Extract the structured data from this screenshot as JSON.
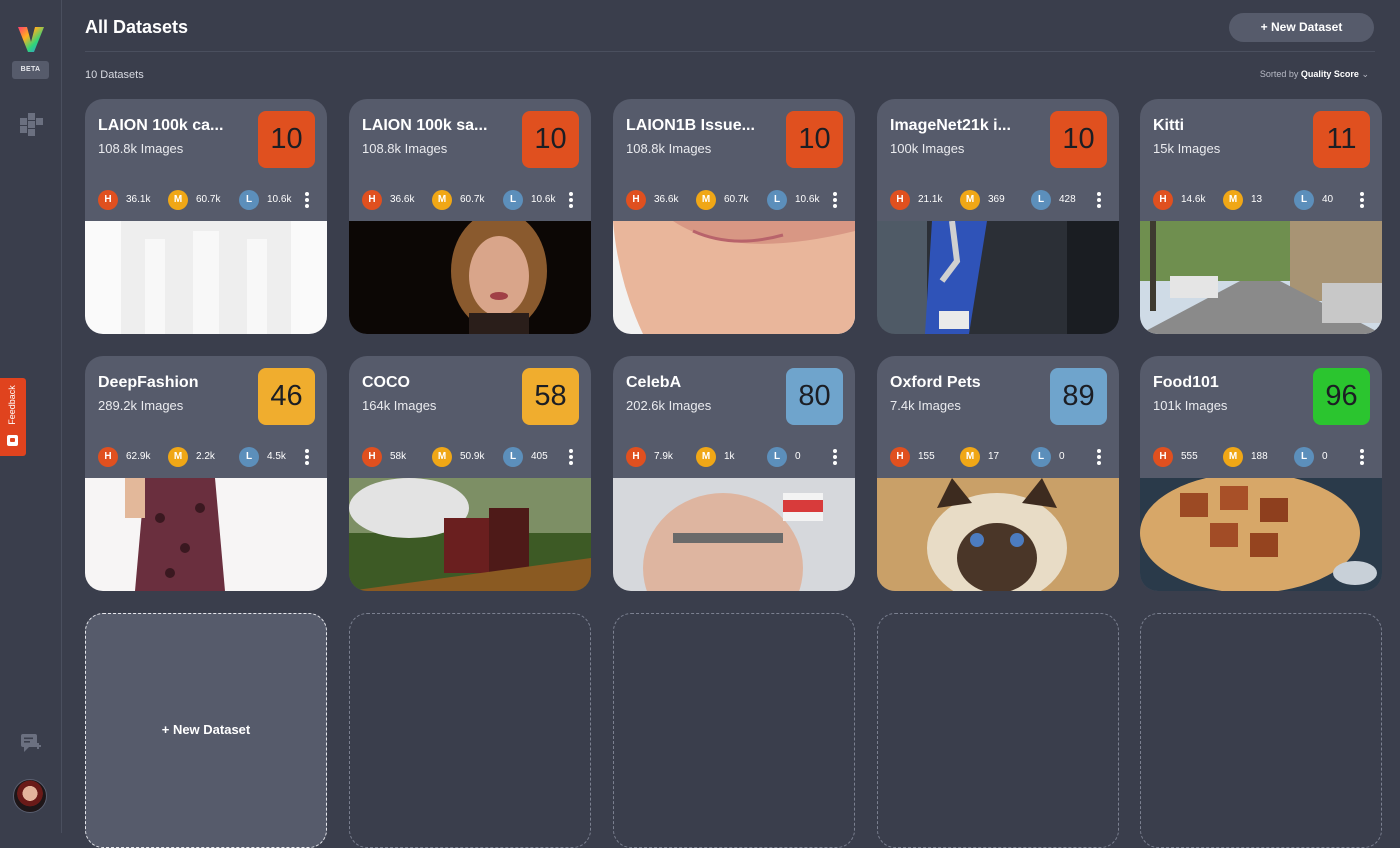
{
  "sidebar": {
    "beta_label": "BETA",
    "feedback_label": "Feedback"
  },
  "header": {
    "title": "All Datasets",
    "new_button": "+ New Dataset",
    "count_label": "10 Datasets",
    "sort_prefix": "Sorted by",
    "sort_value": "Quality Score"
  },
  "colors": {
    "H": "#e0501f",
    "M": "#f0a716",
    "L": "#5c8fbb",
    "score_low": "#e0501f",
    "score_mid": "#f0ad2e",
    "score_high": "#6fa4cc",
    "score_top": "#2bc52f"
  },
  "datasets": [
    {
      "name": "LAION 100k ca...",
      "count": "108.8k Images",
      "score": "10",
      "h": "36.1k",
      "m": "60.7k",
      "l": "10.6k",
      "thumb": "logo-placeholder"
    },
    {
      "name": "LAION 100k sa...",
      "count": "108.8k Images",
      "score": "10",
      "h": "36.6k",
      "m": "60.7k",
      "l": "10.6k",
      "thumb": "portrait-dark"
    },
    {
      "name": "LAION1B Issue...",
      "count": "108.8k Images",
      "score": "10",
      "h": "36.6k",
      "m": "60.7k",
      "l": "10.6k",
      "thumb": "skin-closeup"
    },
    {
      "name": "ImageNet21k i...",
      "count": "100k Images",
      "score": "10",
      "h": "21.1k",
      "m": "369",
      "l": "428",
      "thumb": "runner"
    },
    {
      "name": "Kitti",
      "count": "15k Images",
      "score": "11",
      "h": "14.6k",
      "m": "13",
      "l": "40",
      "thumb": "street"
    },
    {
      "name": "DeepFashion",
      "count": "289.2k Images",
      "score": "46",
      "h": "62.9k",
      "m": "2.2k",
      "l": "4.5k",
      "thumb": "dress"
    },
    {
      "name": "COCO",
      "count": "164k Images",
      "score": "58",
      "h": "58k",
      "m": "50.9k",
      "l": "405",
      "thumb": "train"
    },
    {
      "name": "CelebA",
      "count": "202.6k Images",
      "score": "80",
      "h": "7.9k",
      "m": "1k",
      "l": "0",
      "thumb": "face"
    },
    {
      "name": "Oxford Pets",
      "count": "7.4k Images",
      "score": "89",
      "h": "155",
      "m": "17",
      "l": "0",
      "thumb": "cat"
    },
    {
      "name": "Food101",
      "count": "101k Images",
      "score": "96",
      "h": "555",
      "m": "188",
      "l": "0",
      "thumb": "food"
    }
  ],
  "add_card_label": "+ New Dataset"
}
